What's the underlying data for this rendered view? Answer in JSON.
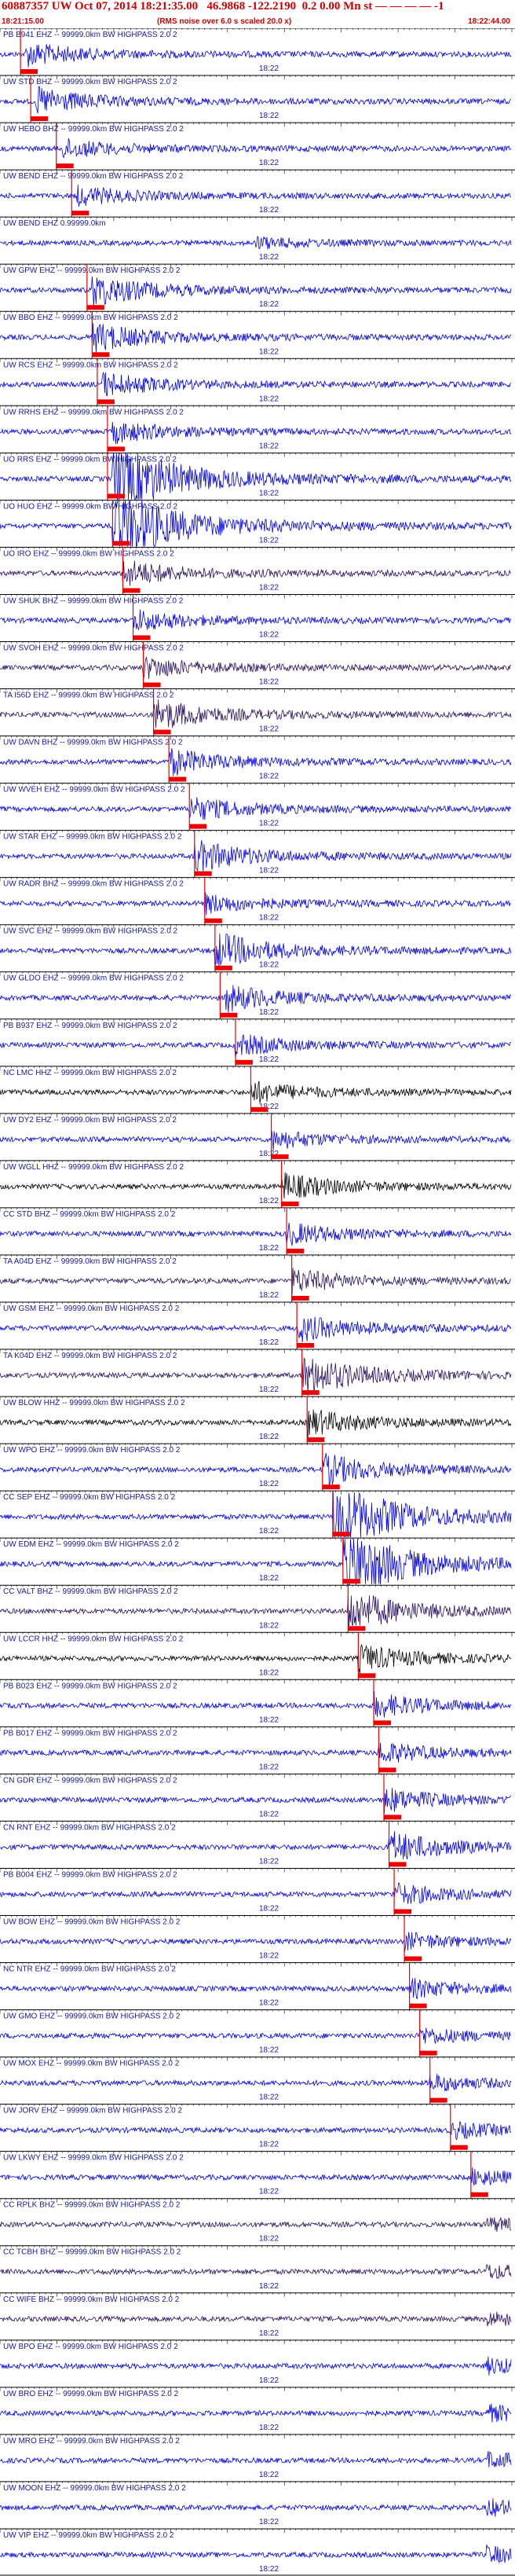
{
  "header": {
    "title": "60887357 UW Oct 07, 2014 18:21:35.00   46.9868 -122.2190  0.2 0.00 Mn st — — — — -1",
    "start_time": "18:21:15.00",
    "end_time": "18:22:44.00",
    "note": "(RMS noise over 6.0 s scaled 20.0 x)"
  },
  "colors": {
    "trace_blue": "#0000ee",
    "trace_dark": "#2a1060",
    "trace_black": "#000000",
    "pick_red": "#ee0000",
    "label_blue": "#1a1aa0",
    "grid": "#000000"
  },
  "chart_data": {
    "type": "line",
    "title": "60887357 UW Oct 07, 2014 18:21:35.00   46.9868 -122.2190  0.2 0.00 Mn st — — — — -1",
    "x_range": [
      "18:21:15.00",
      "18:22:44.00"
    ],
    "minute_tick_label": "18:22",
    "traces": [
      {
        "label": "PB B941 EHZ -- 99999.0km BW HIGHPASS 2.0 2",
        "pick": 0.04,
        "onset": 0.05,
        "amp": 0.45,
        "color": "blue"
      },
      {
        "label": "UW STD BHZ -- 99999.0km BW HIGHPASS 2.0 2",
        "pick": 0.06,
        "onset": 0.07,
        "amp": 0.5,
        "color": "blue"
      },
      {
        "label": "UW HEBO BHZ -- 99999.0km BW HIGHPASS 2.0 2",
        "pick": 0.11,
        "onset": 0.12,
        "amp": 0.35,
        "color": "blue"
      },
      {
        "label": "UW BEND EHZ -- 99999.0km BW HIGHPASS 2.0 2",
        "pick": 0.14,
        "onset": 0.15,
        "amp": 0.35,
        "color": "blue"
      },
      {
        "label": "UW BEND EHZ 0.99999.0km",
        "pick": null,
        "onset": 0.5,
        "amp": 0.2,
        "color": "blue"
      },
      {
        "label": "UW GPW EHZ -- 99999.0km BW HIGHPASS 2.0 2",
        "pick": 0.17,
        "onset": 0.18,
        "amp": 0.6,
        "color": "blue"
      },
      {
        "label": "UW BBO EHZ -- 99999.0km BW HIGHPASS 2.0 2",
        "pick": 0.18,
        "onset": 0.18,
        "amp": 0.55,
        "color": "blue"
      },
      {
        "label": "UW RCS EHZ -- 99999.0km BW HIGHPASS 2.0 2",
        "pick": 0.19,
        "onset": 0.2,
        "amp": 0.45,
        "color": "blue"
      },
      {
        "label": "UW RRHS EHZ -- 99999.0km BW HIGHPASS 2.0 2",
        "pick": 0.21,
        "onset": 0.22,
        "amp": 0.4,
        "color": "blue"
      },
      {
        "label": "UO RRS EHZ -- 99999.0km BW HIGHPASS 2.0 2",
        "pick": 0.21,
        "onset": 0.22,
        "amp": 1.6,
        "color": "blue"
      },
      {
        "label": "UO HUO EHZ -- 99999.0km BW HIGHPASS 2.0 2",
        "pick": 0.22,
        "onset": 0.22,
        "amp": 1.6,
        "color": "blue"
      },
      {
        "label": "UO IRO EHZ -- 99999.0km BW HIGHPASS 2.0 2",
        "pick": 0.24,
        "onset": 0.24,
        "amp": 0.5,
        "color": "dark"
      },
      {
        "label": "UW SHUK BHZ -- 99999.0km BW HIGHPASS 2.0 2",
        "pick": 0.26,
        "onset": 0.26,
        "amp": 0.4,
        "color": "blue"
      },
      {
        "label": "UW SVOH EHZ -- 99999.0km BW HIGHPASS 2.0 2",
        "pick": 0.28,
        "onset": 0.28,
        "amp": 0.4,
        "color": "dark"
      },
      {
        "label": "TA I56D EHZ -- 99999.0km BW HIGHPASS 2.0 2",
        "pick": 0.3,
        "onset": 0.3,
        "amp": 0.6,
        "color": "dark"
      },
      {
        "label": "UW DAVN BHZ -- 99999.0km BW HIGHPASS 2.0 2",
        "pick": 0.33,
        "onset": 0.33,
        "amp": 0.5,
        "color": "blue"
      },
      {
        "label": "UW WVEH EHZ -- 99999.0km BW HIGHPASS 2.0 2",
        "pick": 0.37,
        "onset": 0.37,
        "amp": 0.45,
        "color": "blue"
      },
      {
        "label": "UW STAR EHZ -- 99999.0km BW HIGHPASS 2.0 2",
        "pick": 0.38,
        "onset": 0.38,
        "amp": 0.6,
        "color": "blue"
      },
      {
        "label": "UW RADR BHZ -- 99999.0km BW HIGHPASS 2.0 2",
        "pick": 0.4,
        "onset": 0.4,
        "amp": 0.35,
        "color": "blue"
      },
      {
        "label": "UW SVC EHZ -- 99999.0km BW HIGHPASS 2.0 2",
        "pick": 0.42,
        "onset": 0.42,
        "amp": 0.7,
        "color": "blue"
      },
      {
        "label": "UW GLDO EHZ -- 99999.0km BW HIGHPASS 2.0 2",
        "pick": 0.43,
        "onset": 0.44,
        "amp": 0.5,
        "color": "blue"
      },
      {
        "label": "PB B937 EHZ -- 99999.0km BW HIGHPASS 2.0 2",
        "pick": 0.46,
        "onset": 0.46,
        "amp": 0.4,
        "color": "blue"
      },
      {
        "label": "NC LMC HHZ -- 99999.0km BW HIGHPASS 2.0 2",
        "pick": 0.49,
        "onset": 0.49,
        "amp": 0.4,
        "color": "black"
      },
      {
        "label": "UW DY2 EHZ -- 99999.0km BW HIGHPASS 2.0 2",
        "pick": 0.53,
        "onset": 0.53,
        "amp": 0.35,
        "color": "blue"
      },
      {
        "label": "UW WGLL HHZ -- 99999.0km BW HIGHPASS 2.0 2",
        "pick": 0.55,
        "onset": 0.55,
        "amp": 0.5,
        "color": "black"
      },
      {
        "label": "CC STD BHZ -- 99999.0km BW HIGHPASS 2.0 2",
        "pick": 0.56,
        "onset": 0.56,
        "amp": 0.4,
        "color": "blue"
      },
      {
        "label": "TA A04D EHZ -- 99999.0km BW HIGHPASS 2.0 2",
        "pick": 0.57,
        "onset": 0.57,
        "amp": 0.45,
        "color": "dark"
      },
      {
        "label": "UW GSM EHZ -- 99999.0km BW HIGHPASS 2.0 2",
        "pick": 0.58,
        "onset": 0.58,
        "amp": 0.5,
        "color": "blue"
      },
      {
        "label": "TA K04D EHZ -- 99999.0km BW HIGHPASS 2.0 2",
        "pick": 0.59,
        "onset": 0.59,
        "amp": 0.8,
        "color": "dark"
      },
      {
        "label": "UW BLOW HHZ -- 99999.0km BW HIGHPASS 2.0 2",
        "pick": 0.6,
        "onset": 0.6,
        "amp": 0.5,
        "color": "black"
      },
      {
        "label": "UW WPO EHZ -- 99999.0km BW HIGHPASS 2.0 2",
        "pick": 0.63,
        "onset": 0.63,
        "amp": 0.6,
        "color": "blue"
      },
      {
        "label": "CC SEP EHZ -- 99999.0km BW HIGHPASS 2.0 2",
        "pick": 0.65,
        "onset": 0.65,
        "amp": 1.5,
        "color": "blue"
      },
      {
        "label": "UW EDM EHZ -- 99999.0km BW HIGHPASS 2.0 2",
        "pick": 0.67,
        "onset": 0.67,
        "amp": 1.5,
        "color": "blue"
      },
      {
        "label": "CC VALT BHZ -- 99999.0km BW HIGHPASS 2.0 2",
        "pick": 0.68,
        "onset": 0.68,
        "amp": 0.8,
        "color": "dark"
      },
      {
        "label": "UW LCCR HHZ -- 99999.0km BW HIGHPASS 2.0 2",
        "pick": 0.7,
        "onset": 0.7,
        "amp": 0.5,
        "color": "black"
      },
      {
        "label": "PB B023 EHZ -- 99999.0km BW HIGHPASS 2.0 2",
        "pick": 0.73,
        "onset": 0.73,
        "amp": 0.45,
        "color": "blue"
      },
      {
        "label": "PB B017 EHZ -- 99999.0km BW HIGHPASS 2.0 2",
        "pick": 0.74,
        "onset": 0.74,
        "amp": 0.4,
        "color": "blue"
      },
      {
        "label": "CN GDR EHZ -- 99999.0km BW HIGHPASS 2.0 2",
        "pick": 0.75,
        "onset": 0.75,
        "amp": 0.45,
        "color": "blue"
      },
      {
        "label": "CN RNT EHZ -- 99999.0km BW HIGHPASS 2.0 2",
        "pick": 0.76,
        "onset": 0.76,
        "amp": 0.6,
        "color": "blue"
      },
      {
        "label": "PB B004 EHZ -- 99999.0km BW HIGHPASS 2.0 2",
        "pick": 0.77,
        "onset": 0.77,
        "amp": 0.4,
        "color": "blue"
      },
      {
        "label": "UW BOW EHZ -- 99999.0km BW HIGHPASS 2.0 2",
        "pick": 0.79,
        "onset": 0.79,
        "amp": 0.3,
        "color": "blue"
      },
      {
        "label": "NC NTR EHZ -- 99999.0km BW HIGHPASS 2.0 2",
        "pick": 0.8,
        "onset": 0.8,
        "amp": 0.35,
        "color": "blue"
      },
      {
        "label": "UW GMO EHZ -- 99999.0km BW HIGHPASS 2.0 2",
        "pick": 0.82,
        "onset": 0.82,
        "amp": 0.3,
        "color": "blue"
      },
      {
        "label": "UW MOX EHZ -- 99999.0km BW HIGHPASS 2.0 2",
        "pick": 0.84,
        "onset": 0.84,
        "amp": 0.3,
        "color": "blue"
      },
      {
        "label": "UW JORV EHZ -- 99999.0km BW HIGHPASS 2.0 2",
        "pick": 0.88,
        "onset": 0.88,
        "amp": 0.3,
        "color": "blue"
      },
      {
        "label": "UW LKWY EHZ -- 99999.0km BW HIGHPASS 2.0 2",
        "pick": 0.92,
        "onset": 0.92,
        "amp": 0.3,
        "color": "blue"
      },
      {
        "label": "CC RPLK BHZ -- 99999.0km BW HIGHPASS 2.0 2",
        "pick": null,
        "onset": 0.95,
        "amp": 0.25,
        "color": "dark"
      },
      {
        "label": "CC TCBH BHZ -- 99999.0km BW HIGHPASS 2.0 2",
        "pick": null,
        "onset": 0.95,
        "amp": 0.25,
        "color": "dark"
      },
      {
        "label": "CC WIFE BHZ -- 99999.0km BW HIGHPASS 2.0 2",
        "pick": null,
        "onset": 0.95,
        "amp": 0.25,
        "color": "dark"
      },
      {
        "label": "UW BPO EHZ -- 99999.0km BW HIGHPASS 2.0 2",
        "pick": null,
        "onset": 0.95,
        "amp": 0.3,
        "color": "blue"
      },
      {
        "label": "UW BRO EHZ -- 99999.0km BW HIGHPASS 2.0 2",
        "pick": null,
        "onset": 0.95,
        "amp": 0.3,
        "color": "blue"
      },
      {
        "label": "UW MRO EHZ -- 99999.0km BW HIGHPASS 2.0 2",
        "pick": null,
        "onset": 0.95,
        "amp": 0.3,
        "color": "blue"
      },
      {
        "label": "UW MOON EHZ -- 99999.0km BW HIGHPASS 2.0 2",
        "pick": null,
        "onset": 0.95,
        "amp": 0.3,
        "color": "blue"
      },
      {
        "label": "UW VIP EHZ -- 99999.0km BW HIGHPASS 2.0 2",
        "pick": null,
        "onset": 0.95,
        "amp": 0.3,
        "color": "blue"
      }
    ]
  }
}
